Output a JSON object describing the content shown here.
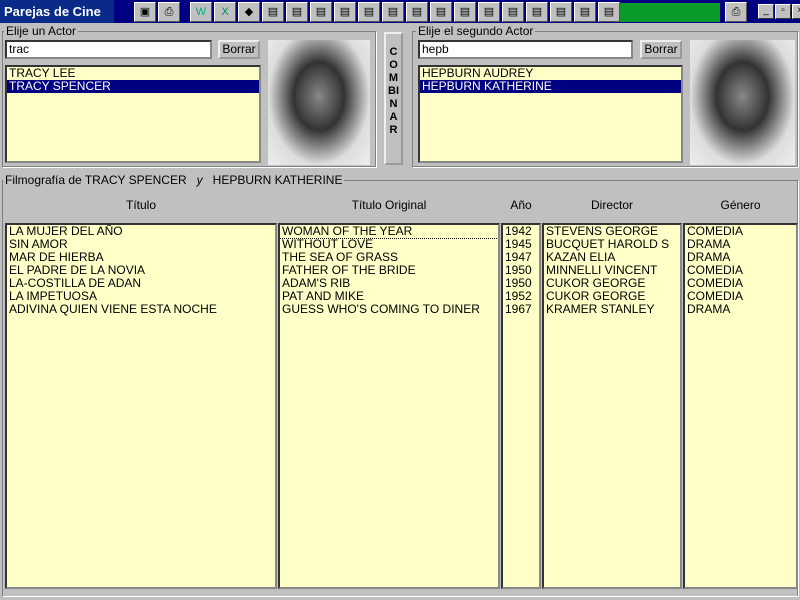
{
  "window": {
    "title": "Parejas de Cine"
  },
  "toolbar": {
    "icons": [
      "app-icon",
      "printer-icon",
      "word-icon",
      "excel-icon",
      "palette-icon",
      "folder-icon",
      "folder-icon",
      "folder-icon",
      "folder-icon",
      "folder-icon",
      "folder-icon",
      "folder-icon",
      "folder-icon",
      "folder-icon",
      "folder-icon",
      "folder-icon",
      "folder-icon",
      "folder-icon",
      "folder-icon",
      "folder-icon"
    ],
    "minimize": "_",
    "restore": "▫",
    "close": "×"
  },
  "actor1": {
    "label": "Elije un Actor",
    "search": "trac",
    "clear": "Borrar",
    "items": [
      "TRACY LEE",
      "TRACY SPENCER"
    ],
    "selected": 1
  },
  "combine": "COMBINAR",
  "actor2": {
    "label": "Elije el segundo Actor",
    "search": "hepb",
    "clear": "Borrar",
    "items": [
      "HEPBURN AUDREY",
      "HEPBURN KATHERINE"
    ],
    "selected": 1
  },
  "filmography": {
    "label_prefix": "Filmografía de TRACY SPENCER",
    "label_join": "y",
    "label_second": "HEPBURN KATHERINE",
    "headers": [
      "Título",
      "Título Original",
      "Año",
      "Director",
      "Género"
    ],
    "rows": [
      [
        "LA MUJER DEL AÑO",
        "WOMAN OF THE YEAR",
        "1942",
        "STEVENS GEORGE",
        "COMEDIA"
      ],
      [
        "SIN AMOR",
        "WITHOUT LOVE",
        "1945",
        "BUCQUET HAROLD S",
        "DRAMA"
      ],
      [
        "MAR DE HIERBA",
        "THE SEA OF GRASS",
        "1947",
        "KAZAN ELIA",
        "DRAMA"
      ],
      [
        "EL PADRE DE LA NOVIA",
        "FATHER OF THE BRIDE",
        "1950",
        "MINNELLI VINCENT",
        "COMEDIA"
      ],
      [
        "LA-COSTILLA DE ADAN",
        "ADAM'S RIB",
        "1950",
        "CUKOR GEORGE",
        "COMEDIA"
      ],
      [
        "LA IMPETUOSA",
        "PAT AND MIKE",
        "1952",
        "CUKOR GEORGE",
        "COMEDIA"
      ],
      [
        "ADIVINA QUIEN VIENE ESTA NOCHE",
        "GUESS WHO'S COMING TO DINER",
        "1967",
        "KRAMER STANLEY",
        "DRAMA"
      ]
    ]
  }
}
